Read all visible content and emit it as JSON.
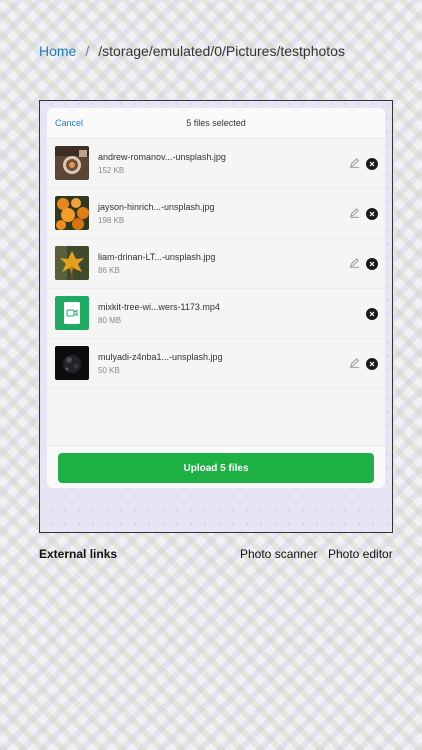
{
  "breadcrumb": {
    "home": "Home",
    "separator": "/",
    "path": "/storage/emulated/0/Pictures/testphotos"
  },
  "modal": {
    "cancel_label": "Cancel",
    "title": "5 files selected",
    "files": [
      {
        "name": "andrew-romanov...-unsplash.jpg",
        "size": "152 KB",
        "thumb": "coffee-photo"
      },
      {
        "name": "jayson-hinrich...-unsplash.jpg",
        "size": "198 KB",
        "thumb": "oranges-photo"
      },
      {
        "name": "liam-drinan-LT...-unsplash.jpg",
        "size": "86 KB",
        "thumb": "leaf-photo"
      },
      {
        "name": "mixkit-tree-wi...wers-1173.mp4",
        "size": "80 MB",
        "thumb": "video-icon"
      },
      {
        "name": "mulyadi-z4nba1...-unsplash.jpg",
        "size": "50 KB",
        "thumb": "dark-photo"
      }
    ],
    "upload_label": "Upload 5 files",
    "accent_color": "#1db042",
    "link_color": "#1f7ac4"
  },
  "external": {
    "heading": "External links",
    "links": [
      "Photo scanner",
      "Photo editor"
    ]
  }
}
